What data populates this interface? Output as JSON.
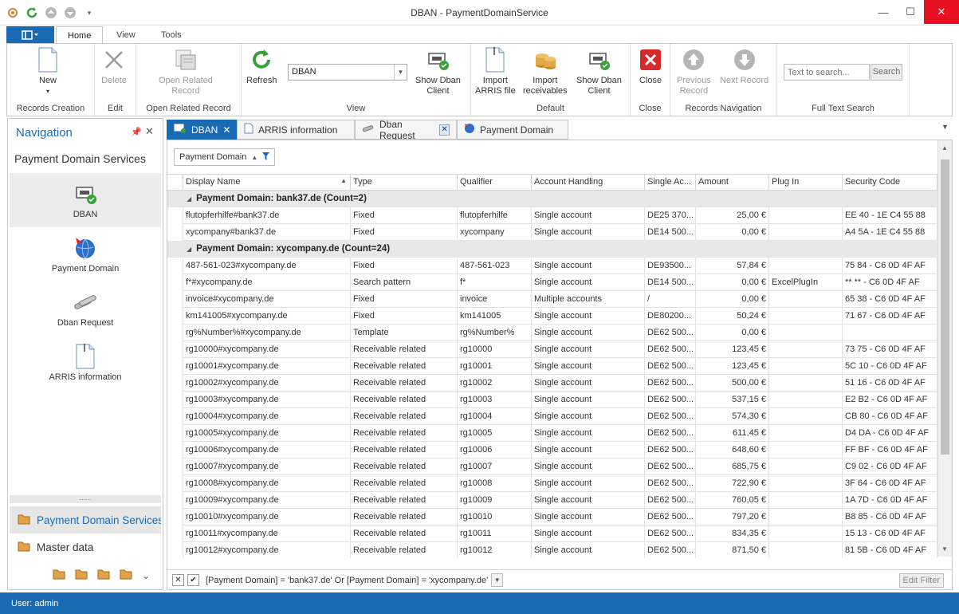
{
  "window": {
    "title": "DBAN - PaymentDomainService"
  },
  "ribbon_tabs": [
    "Home",
    "View",
    "Tools"
  ],
  "ribbon": {
    "groups": {
      "records_creation": "Records Creation",
      "edit": "Edit",
      "open_related": "Open Related Record",
      "view": "View",
      "default": "Default",
      "close": "Close",
      "records_navigation": "Records Navigation",
      "full_text_search": "Full Text Search"
    },
    "buttons": {
      "new": "New",
      "delete": "Delete",
      "open_related_1": "Open Related",
      "open_related_2": "Record",
      "refresh": "Refresh",
      "show_dban_client_1": "Show Dban",
      "show_dban_client_2": "Client",
      "import_arris_1": "Import",
      "import_arris_2": "ARRIS file",
      "import_receivables_1": "Import",
      "import_receivables_2": "receivables",
      "show_dban_client_b_1": "Show Dban",
      "show_dban_client_b_2": "Client",
      "close": "Close",
      "previous_record_1": "Previous",
      "previous_record_2": "Record",
      "next_record": "Next Record",
      "search": "Search"
    },
    "view_select": "DBAN",
    "search_placeholder": "Text to search..."
  },
  "navigation": {
    "title": "Navigation",
    "group_title": "Payment Domain Services",
    "items": [
      "DBAN",
      "Payment Domain",
      "Dban Request",
      "ARRIS information"
    ],
    "categories": [
      "Payment Domain Services",
      "Master data"
    ]
  },
  "doc_tabs": [
    "DBAN",
    "ARRIS information",
    "Dban Request",
    "Payment Domain"
  ],
  "grid": {
    "group_chip": "Payment Domain",
    "columns": [
      "Display Name",
      "Type",
      "Qualifier",
      "Account Handling",
      "Single Ac...",
      "Amount",
      "Plug In",
      "Security Code"
    ],
    "rows": [
      {
        "group": "Payment Domain: bank37.de (Count=2)"
      },
      {
        "cells": [
          "flutopferhilfe#bank37.de",
          "Fixed",
          "flutopferhilfe",
          "Single account",
          "DE25 370...",
          "25,00 €",
          "",
          "EE 40 - 1E C4 55 88"
        ]
      },
      {
        "cells": [
          "xycompany#bank37.de",
          "Fixed",
          "xycompany",
          "Single account",
          "DE14 500...",
          "0,00 €",
          "",
          "A4 5A - 1E C4 55 88"
        ]
      },
      {
        "group": "Payment Domain: xycompany.de (Count=24)"
      },
      {
        "cells": [
          "487-561-023#xycompany.de",
          "Fixed",
          "487-561-023",
          "Single account",
          "DE93500...",
          "57,84 €",
          "",
          "75 84 - C6 0D 4F AF"
        ]
      },
      {
        "cells": [
          "f*#xycompany.de",
          "Search pattern",
          "f*",
          "Single account",
          "DE14 500...",
          "0,00 €",
          "ExcelPlugIn",
          "** ** - C6 0D 4F AF"
        ]
      },
      {
        "cells": [
          "invoice#xycompany.de",
          "Fixed",
          "invoice",
          "Multiple accounts",
          "/",
          "0,00 €",
          "",
          "65 38 - C6 0D 4F AF"
        ]
      },
      {
        "cells": [
          "km141005#xycompany.de",
          "Fixed",
          "km141005",
          "Single account",
          "DE80200...",
          "50,24 €",
          "",
          "71 67 - C6 0D 4F AF"
        ]
      },
      {
        "cells": [
          "rg%Number%#xycompany.de",
          "Template",
          "rg%Number%",
          "Single account",
          "DE62 500...",
          "0,00 €",
          "",
          ""
        ]
      },
      {
        "cells": [
          "rg10000#xycompany.de",
          "Receivable related",
          "rg10000",
          "Single account",
          "DE62 500...",
          "123,45 €",
          "",
          "73 75 - C6 0D 4F AF"
        ]
      },
      {
        "cells": [
          "rg10001#xycompany.de",
          "Receivable related",
          "rg10001",
          "Single account",
          "DE62 500...",
          "123,45 €",
          "",
          "5C 10 - C6 0D 4F AF"
        ]
      },
      {
        "cells": [
          "rg10002#xycompany.de",
          "Receivable related",
          "rg10002",
          "Single account",
          "DE62 500...",
          "500,00 €",
          "",
          "51 16 - C6 0D 4F AF"
        ]
      },
      {
        "cells": [
          "rg10003#xycompany.de",
          "Receivable related",
          "rg10003",
          "Single account",
          "DE62 500...",
          "537,15 €",
          "",
          "E2 B2 - C6 0D 4F AF"
        ]
      },
      {
        "cells": [
          "rg10004#xycompany.de",
          "Receivable related",
          "rg10004",
          "Single account",
          "DE62 500...",
          "574,30 €",
          "",
          "CB 80 - C6 0D 4F AF"
        ]
      },
      {
        "cells": [
          "rg10005#xycompany.de",
          "Receivable related",
          "rg10005",
          "Single account",
          "DE62 500...",
          "611,45 €",
          "",
          "D4 DA - C6 0D 4F AF"
        ]
      },
      {
        "cells": [
          "rg10006#xycompany.de",
          "Receivable related",
          "rg10006",
          "Single account",
          "DE62 500...",
          "648,60 €",
          "",
          "FF BF - C6 0D 4F AF"
        ]
      },
      {
        "cells": [
          "rg10007#xycompany.de",
          "Receivable related",
          "rg10007",
          "Single account",
          "DE62 500...",
          "685,75 €",
          "",
          "C9 02 - C6 0D 4F AF"
        ]
      },
      {
        "cells": [
          "rg10008#xycompany.de",
          "Receivable related",
          "rg10008",
          "Single account",
          "DE62 500...",
          "722,90 €",
          "",
          "3F 64 - C6 0D 4F AF"
        ]
      },
      {
        "cells": [
          "rg10009#xycompany.de",
          "Receivable related",
          "rg10009",
          "Single account",
          "DE62 500...",
          "760,05 €",
          "",
          "1A 7D - C6 0D 4F AF"
        ]
      },
      {
        "cells": [
          "rg10010#xycompany.de",
          "Receivable related",
          "rg10010",
          "Single account",
          "DE62 500...",
          "797,20 €",
          "",
          "B8 85 - C6 0D 4F AF"
        ]
      },
      {
        "cells": [
          "rg10011#xycompany.de",
          "Receivable related",
          "rg10011",
          "Single account",
          "DE62 500...",
          "834,35 €",
          "",
          "15 13 - C6 0D 4F AF"
        ]
      },
      {
        "cells": [
          "rg10012#xycompany.de",
          "Receivable related",
          "rg10012",
          "Single account",
          "DE62 500...",
          "871,50 €",
          "",
          "81 5B - C6 0D 4F AF"
        ]
      }
    ],
    "filter_text": "[Payment Domain] = 'bank37.de' Or [Payment Domain] = 'xycompany.de'",
    "edit_filter": "Edit Filter"
  },
  "status": {
    "user": "User: admin"
  },
  "colors": {
    "accent": "#1a6ab3",
    "close_red": "#e81123"
  }
}
